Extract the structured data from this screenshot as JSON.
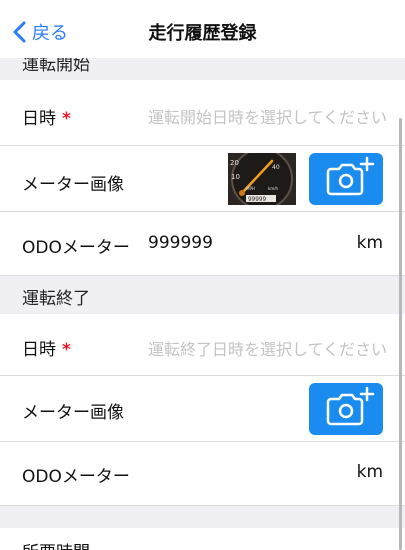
{
  "nav": {
    "back_label": "戻る",
    "title": "走行履歴登録"
  },
  "start": {
    "header": "運転開始",
    "datetime_label": "日時",
    "required_mark": "*",
    "datetime_placeholder": "運転開始日時を選択してください",
    "meter_image_label": "メーター画像",
    "odo_label": "ODOメーター",
    "odo_value": "999999",
    "odo_unit": "km"
  },
  "end": {
    "header": "運転終了",
    "datetime_label": "日時",
    "required_mark": "*",
    "datetime_placeholder": "運転終了日時を選択してください",
    "meter_image_label": "メーター画像",
    "odo_label": "ODOメーター",
    "odo_value": "",
    "odo_unit": "km"
  },
  "next_section": {
    "header": "所要時間"
  },
  "colors": {
    "accent": "#1a8cf0",
    "required": "#e0192a",
    "placeholder": "#c4c4c6",
    "section_bg": "#efeff4"
  },
  "icons": {
    "back": "chevron-left-icon",
    "camera_add": "camera-plus-icon"
  }
}
